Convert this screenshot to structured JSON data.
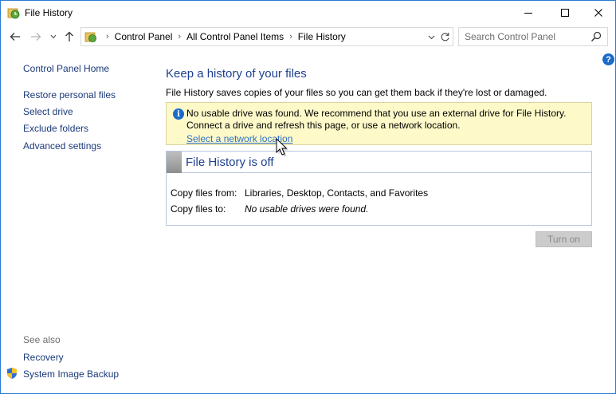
{
  "window": {
    "title": "File History",
    "controls": [
      "minimize",
      "maximize",
      "close"
    ]
  },
  "nav": {
    "breadcrumbs": [
      "Control Panel",
      "All Control Panel Items",
      "File History"
    ],
    "search_placeholder": "Search Control Panel"
  },
  "sidebar": {
    "home": "Control Panel Home",
    "links": [
      "Restore personal files",
      "Select drive",
      "Exclude folders",
      "Advanced settings"
    ],
    "see_also_label": "See also",
    "see_also": [
      "Recovery",
      "System Image Backup"
    ]
  },
  "main": {
    "heading": "Keep a history of your files",
    "description": "File History saves copies of your files so you can get them back if they're lost or damaged.",
    "warning": {
      "text": "No usable drive was found. We recommend that you use an external drive for File History. Connect a drive and refresh this page, or use a network location.",
      "link": "Select a network location"
    },
    "status": {
      "title": "File History is off",
      "rows": [
        {
          "label": "Copy files from:",
          "value": "Libraries, Desktop, Contacts, and Favorites"
        },
        {
          "label": "Copy files to:",
          "value": "No usable drives were found."
        }
      ]
    },
    "turn_on_label": "Turn on"
  },
  "colors": {
    "accent_link": "#1a3a7a",
    "heading": "#1e3f8f",
    "warning_bg": "#fdf9c9",
    "info_blue": "#1c6bc9",
    "window_border": "#2b7bd6"
  },
  "icons": [
    "file-history-icon",
    "back-arrow-icon",
    "forward-arrow-icon",
    "chevron-down-icon",
    "up-arrow-icon",
    "refresh-icon",
    "search-icon",
    "help-icon",
    "info-icon",
    "shield-icon",
    "mouse-cursor-icon"
  ]
}
